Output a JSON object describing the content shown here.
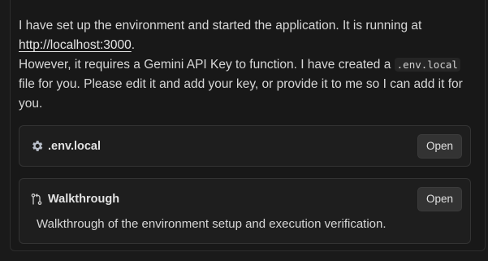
{
  "message": {
    "line1": "I have set up the environment and started the application. It is running at",
    "url": "http://localhost:3000",
    "after_url": ".",
    "line3": "However, it requires a Gemini API Key to function. I have created a ",
    "file_code": ".env.local",
    "line4": " file for you. Please edit it and add your key, or provide it to me so I can add it for you."
  },
  "cards": [
    {
      "icon": "gear-icon",
      "title": ".env.local",
      "button": "Open"
    },
    {
      "icon": "git-diff-icon",
      "title": "Walkthrough",
      "button": "Open",
      "description": "Walkthrough of the environment setup and execution verification."
    }
  ]
}
